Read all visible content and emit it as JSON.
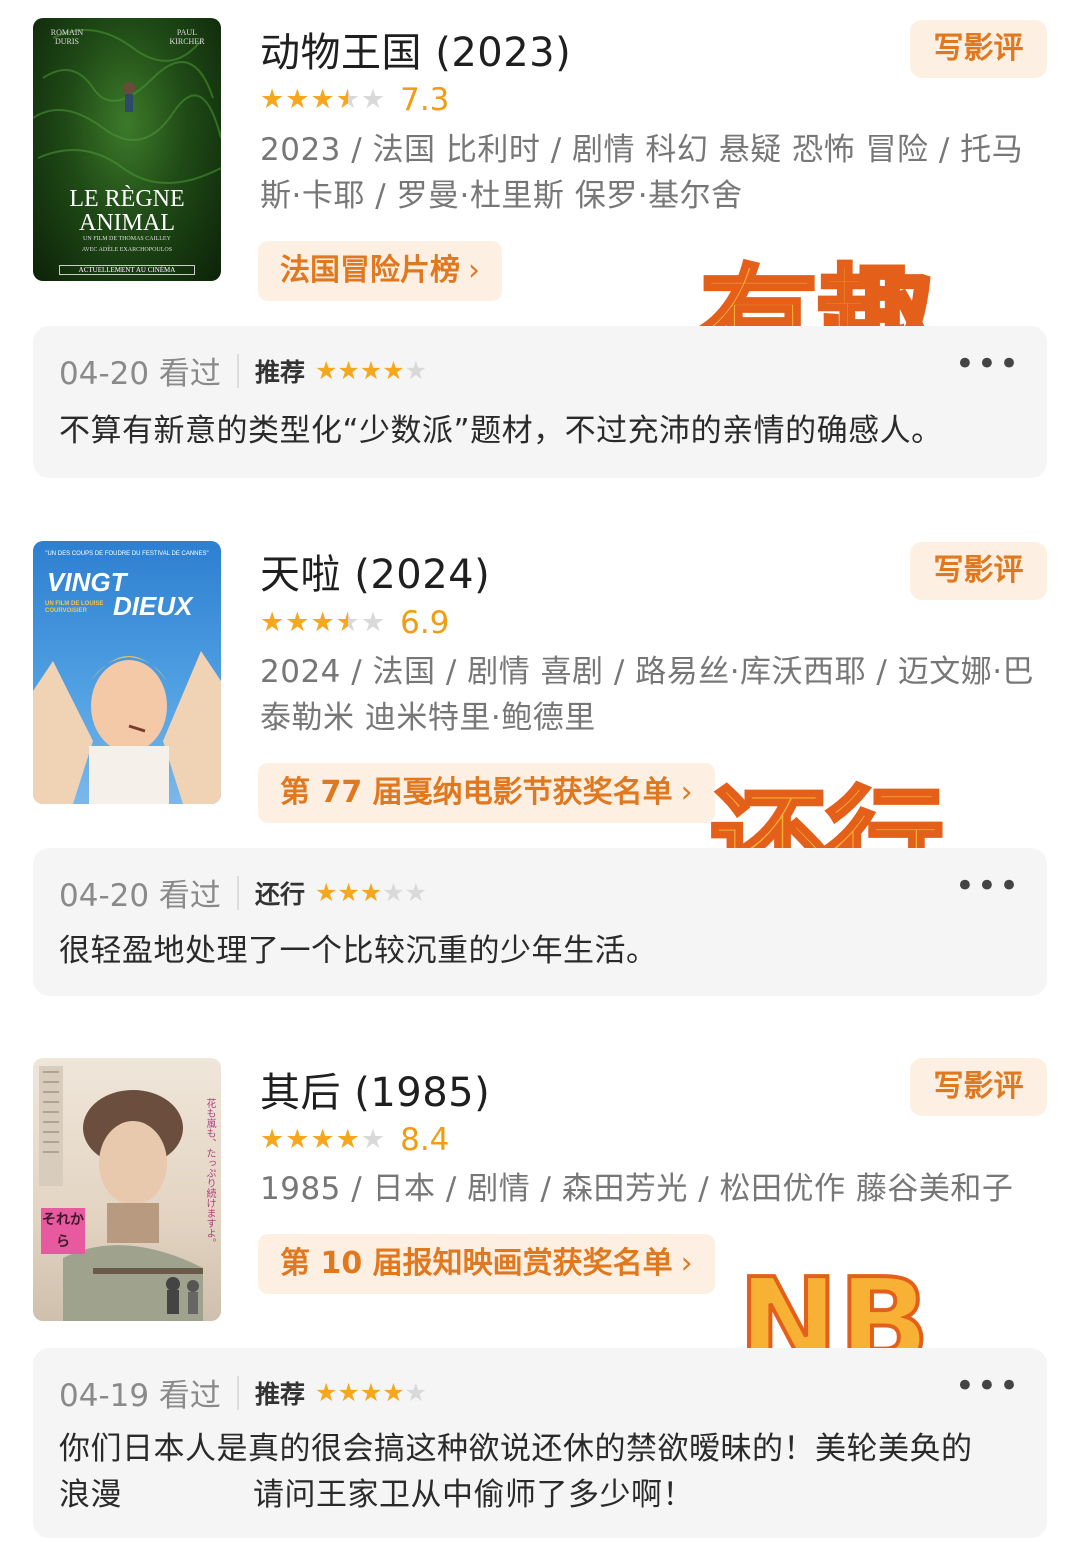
{
  "colors": {
    "accent": "#e07820",
    "star": "#f6a71b",
    "star_empty": "#d9d9d9",
    "chip_bg": "#fdf0e3",
    "card_bg": "#f5f5f5"
  },
  "movies": [
    {
      "title": "动物王国 (2023)",
      "stars": 3.5,
      "rating": "7.3",
      "meta": "2023 / 法国 比利时 / 剧情 科幻 悬疑 恐怖 冒险 / 托马斯·卡耶 / 罗曼·杜里斯 保罗·基尔舍",
      "list_label": "法国冒险片榜",
      "review_button": "写影评",
      "watched": "04-20 看过",
      "verdict": "推荐",
      "my_stars": 4,
      "comment": "不算有新意的类型化“少数派”题材，不过充沛的亲情的确感人。",
      "overlay": "有趣",
      "poster": {
        "credit_left": "ROMAIN DURIS",
        "credit_right": "PAUL KIRCHER",
        "title_line1": "LE RÈGNE",
        "title_line2": "ANIMAL",
        "byline": "UN FILM DE THOMAS CAILLEY",
        "cast": "AVEC ADÈLE EXARCHOPOULOS",
        "release": "ACTUELLEMENT AU CINÉMA"
      }
    },
    {
      "title": "天啦 (2024)",
      "stars": 3.5,
      "rating": "6.9",
      "meta": "2024 / 法国 / 剧情 喜剧 / 路易丝·库沃西耶 / 迈文娜·巴泰勒米 迪米特里·鲍德里",
      "list_label": "第 77 届戛纳电影节获奖名单",
      "review_button": "写影评",
      "watched": "04-20 看过",
      "verdict": "还行",
      "my_stars": 3,
      "comment": "很轻盈地处理了一个比较沉重的少年生活。",
      "overlay": "还行",
      "poster": {
        "tagline": "\"UN DES COUPS DE FOUDRE DU FESTIVAL DE CANNES\"",
        "title_line1": "VINGT",
        "title_line2": "DIEUX",
        "director": "UN FILM DE LOUISE COURVOISIER"
      }
    },
    {
      "title": "其后 (1985)",
      "stars": 4,
      "rating": "8.4",
      "meta": "1985 / 日本 / 剧情 / 森田芳光 / 松田优作 藤谷美和子",
      "list_label": "第 10 届报知映画赏获奖名单",
      "review_button": "写影评",
      "watched": "04-19 看过",
      "verdict": "推荐",
      "my_stars": 4,
      "comment_line1": "你们日本人是真的很会搞这种欲说还休的禁欲暧昧的！美轮美奂的",
      "comment_line2": "浪漫",
      "comment_line3": "请问王家卫从中偷师了多少啊！",
      "overlay": "NB",
      "poster": {
        "stamp": "それから",
        "side_text": "花も嵐も、たっぷり続けますよ。"
      }
    }
  ]
}
